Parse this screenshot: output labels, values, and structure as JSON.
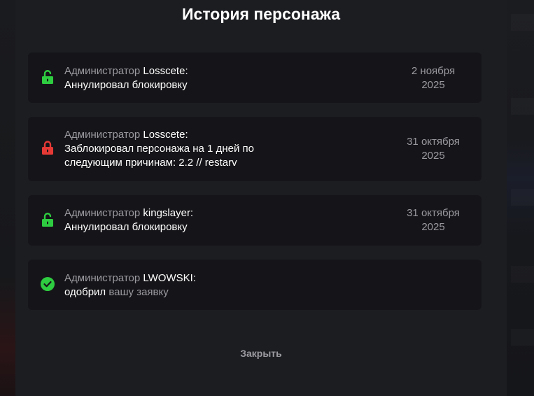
{
  "modal": {
    "title": "История персонажа",
    "close_label": "Закрыть"
  },
  "entries": [
    {
      "icon": "unlock-icon",
      "role": "Администратор",
      "admin": "Losscete:",
      "line1": "Аннулировал блокировку",
      "date_line1": "2 ноября",
      "date_line2": "2025"
    },
    {
      "icon": "lock-icon",
      "role": "Администратор",
      "admin": "Losscete:",
      "line1": "Заблокировал персонажа на 1 дней по",
      "line2": "следующим причинам: 2.2 // restarv",
      "date_line1": "31 октября",
      "date_line2": "2025"
    },
    {
      "icon": "unlock-icon",
      "role": "Администратор",
      "admin": "kingslayer:",
      "line1": "Аннулировал блокировку",
      "date_line1": "31 октября",
      "date_line2": "2025"
    },
    {
      "icon": "check-circle-icon",
      "role": "Администратор",
      "admin": "LWOWSKI:",
      "action": "одобрил",
      "action_rest": "вашу заявку"
    }
  ],
  "colors": {
    "unlock": "#2ecc40",
    "lock": "#e53935",
    "check": "#2ecc40",
    "modal_bg": "#1c1d21",
    "entry_bg": "#151519"
  }
}
